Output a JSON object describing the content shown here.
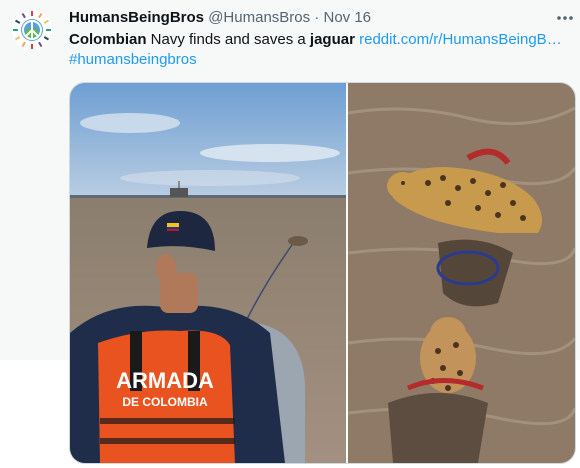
{
  "tweet": {
    "author_name": "HumansBeingBros",
    "handle": "@HumansBros",
    "separator": "·",
    "date": "Nov 16",
    "text_bold_1": "Colombian",
    "text_plain_1": " Navy finds and saves a ",
    "text_bold_2": "jaguar",
    "text_space": " ",
    "link": "reddit.com/r/HumansBeingB…",
    "hashtag": "#humansbeingbros"
  },
  "media": {
    "vest_line_1": "ARMADA",
    "vest_line_2": "DE COLOMBIA"
  },
  "icons": {
    "avatar": "peace-sign-avatar-icon",
    "more": "more-options-icon"
  },
  "colors": {
    "link": "#1d9bf0",
    "text": "#0f1419",
    "muted": "#536471",
    "vest": "#e8531f"
  }
}
